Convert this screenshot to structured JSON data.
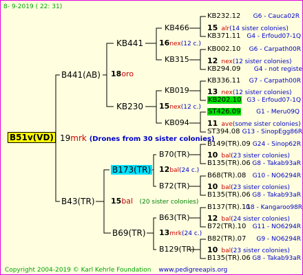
{
  "date": "8-  9-2019 ( 22: 31)",
  "root": "B51v(VD)",
  "root_num": "19",
  "root_breeder": "mrk",
  "root_note": "(Drones from 30 sister colonies)",
  "sire": {
    "name": "B441(AB)",
    "num": "18",
    "breeder": "oro",
    "sire": {
      "name": "KB441",
      "num": "16",
      "breeder": "nex",
      "note": "(12 c.)",
      "sire": {
        "name": "KB466",
        "num": "15",
        "breeder": "alr",
        "note": "(14 sister colonies)"
      },
      "dam": {
        "name": "KB315",
        "num": "12",
        "breeder": "nex",
        "note": "(12 sister colonies)"
      }
    },
    "dam": {
      "name": "KB230",
      "num": "15",
      "breeder": "nex",
      "note": "(12 c.)",
      "sire": {
        "name": "KB019",
        "num": "13",
        "breeder": "nex",
        "note": "(12 sister colonies)"
      },
      "dam": {
        "name": "KB094",
        "num": "11",
        "breeder": "ave",
        "note": "(some sister colonies)"
      }
    }
  },
  "dam": {
    "name": "B43(TR)",
    "num": "15",
    "breeder": "bal",
    "note": "(20 sister colonies)",
    "sire": {
      "name": "B173(TR)",
      "num": "12",
      "breeder": "bal",
      "note": "(24 c.)",
      "sire": {
        "name": "B70(TR)",
        "num": "10",
        "breeder": "bal",
        "note": "(23 sister colonies)"
      },
      "dam": {
        "name": "B72(TR)",
        "num": "10",
        "breeder": "bal",
        "note": "(23 sister colonies)"
      }
    },
    "dam": {
      "name": "B69(TR)",
      "num": "13",
      "breeder": "mrk",
      "note": "(24 c.)",
      "sire": {
        "name": "B63(TR)",
        "num": "12",
        "breeder": "bal",
        "note": "(24 sister colonies)"
      },
      "dam": {
        "name": "B129(TR)",
        "num": "10",
        "breeder": "bal",
        "note": "(23 sister colonies)"
      }
    }
  },
  "gen4": [
    {
      "name": "KB232.12",
      "ref": "G6 - Cauca02R"
    },
    {
      "name": "KB371.11",
      "ref": "G4 - Erfoud07-1Q"
    },
    {
      "name": "KB002.10",
      "ref": "G6 - Carpath00R"
    },
    {
      "name": "KB294.09",
      "ref": "G4 - not registe"
    },
    {
      "name": "KB336.11",
      "ref": "G7 - Carpath00R"
    },
    {
      "name": "KB202.10",
      "ref": "G3 - Erfoud07-1Q"
    },
    {
      "name": "ST426.09",
      "ref": "G1 - Meru09Q"
    },
    {
      "name": "ST394.08",
      "ref": "G13 - SinopEgg86R"
    },
    {
      "name": "B149(TR).09",
      "ref": "G24 - Sinop62R"
    },
    {
      "name": "B135(TR).06",
      "ref": "G8 - Takab93aR"
    },
    {
      "name": "B68(TR).08",
      "ref": "G10 - NO6294R"
    },
    {
      "name": "B135(TR).06",
      "ref": "G8 - Takab93aR"
    },
    {
      "name": "B137(TR).11",
      "ref": "G8 - Kangaroo98R"
    },
    {
      "name": "B72(TR).10",
      "ref": "G11 - NO6294R"
    },
    {
      "name": "B82(TR).07",
      "ref": "G9 - NO6294R"
    },
    {
      "name": "B135(TR).06",
      "ref": "G8 - Takab93aR"
    }
  ],
  "footer": "Copyright 2004-2019 © Karl Kehrle Foundation",
  "footer_url": "www.pedigreeapis.org"
}
